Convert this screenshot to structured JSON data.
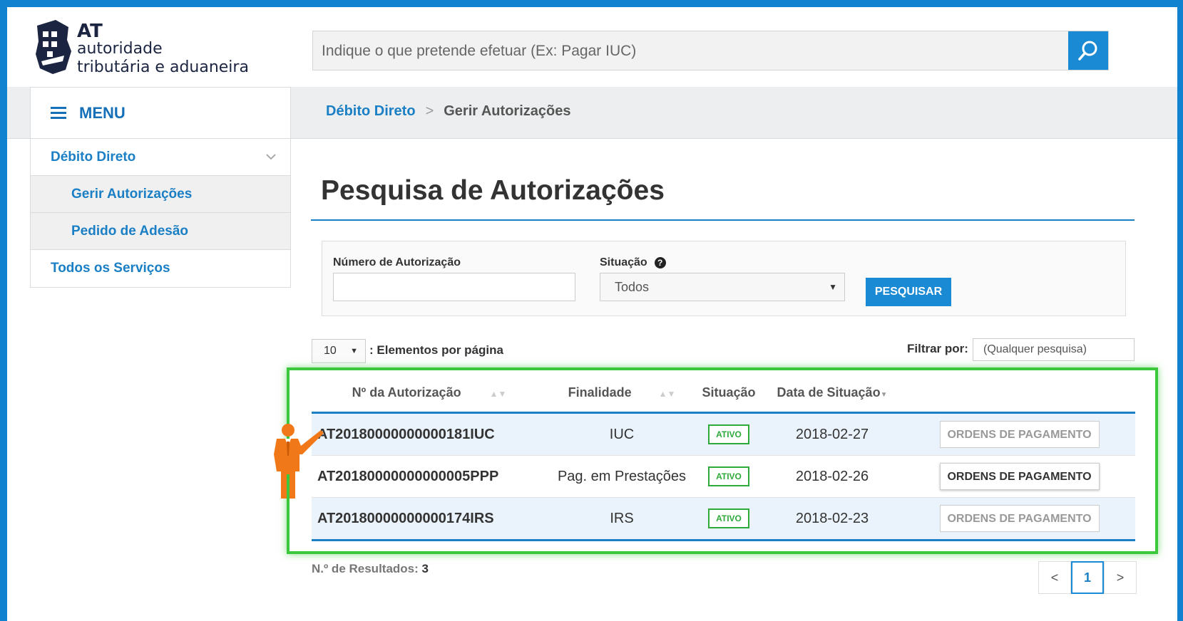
{
  "logo": {
    "line1": "AT",
    "line2": "autoridade",
    "line3": "tributária e aduaneira"
  },
  "search": {
    "placeholder": "Indique o que pretende efetuar (Ex: Pagar IUC)"
  },
  "menu": {
    "label": "MENU"
  },
  "breadcrumb": {
    "link": "Débito Direto",
    "separator": ">",
    "current": "Gerir Autorizações"
  },
  "sidebar": {
    "items": [
      {
        "label": "Débito Direto"
      },
      {
        "label": "Gerir Autorizações"
      },
      {
        "label": "Pedido de Adesão"
      },
      {
        "label": "Todos os Serviços"
      }
    ]
  },
  "page": {
    "title": "Pesquisa de Autorizações"
  },
  "form": {
    "numero_label": "Número de Autorização",
    "numero_value": "",
    "situacao_label": "Situação",
    "situacao_value": "Todos",
    "search_button": "PESQUISAR"
  },
  "pagination_controls": {
    "per_page_value": "10",
    "per_page_label": ": Elementos por página",
    "filter_label": "Filtrar por:",
    "filter_placeholder": "(Qualquer pesquisa)"
  },
  "table": {
    "headers": [
      "Nº da Autorização",
      "Finalidade",
      "Situação",
      "Data de Situação"
    ],
    "rows": [
      {
        "numero": "AT20180000000000181IUC",
        "finalidade": "IUC",
        "situacao": "ATIVO",
        "data": "2018-02-27",
        "action": "ORDENS DE PAGAMENTO"
      },
      {
        "numero": "AT20180000000000005PPP",
        "finalidade": "Pag. em Prestações",
        "situacao": "ATIVO",
        "data": "2018-02-26",
        "action": "ORDENS DE PAGAMENTO"
      },
      {
        "numero": "AT20180000000000174IRS",
        "finalidade": "IRS",
        "situacao": "ATIVO",
        "data": "2018-02-23",
        "action": "ORDENS DE PAGAMENTO"
      }
    ]
  },
  "results": {
    "label": "N.º de Resultados:",
    "count": "3"
  },
  "pager": {
    "prev": "<",
    "current": "1",
    "next": ">"
  },
  "colors": {
    "frame": "#1082d0",
    "link": "#1a7fc4",
    "highlight": "#3cc83c",
    "badge": "#2eaa3a",
    "pointer": "#f07818"
  }
}
